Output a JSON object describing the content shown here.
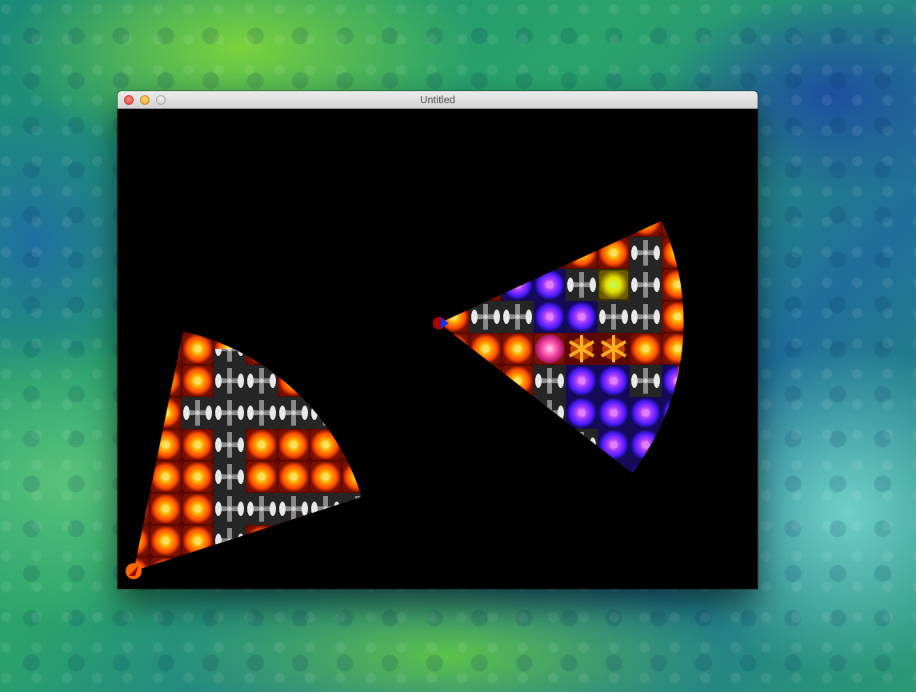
{
  "window": {
    "title": "Untitled"
  },
  "controls": {
    "close": "close-button",
    "minimize": "minimize-button",
    "zoom": "zoom-button"
  },
  "colors": {
    "canvas_background": "#000000",
    "orange_tile": "#ff8a1a",
    "blue_tile": "#6a2cff",
    "gray_tile": "#3a3a3a",
    "yellow_tile": "#e8d800",
    "pink_tile": "#ff4aa0"
  },
  "icons": {
    "player_left": "player-arrow-icon",
    "player_right": "player-arrow-icon"
  }
}
